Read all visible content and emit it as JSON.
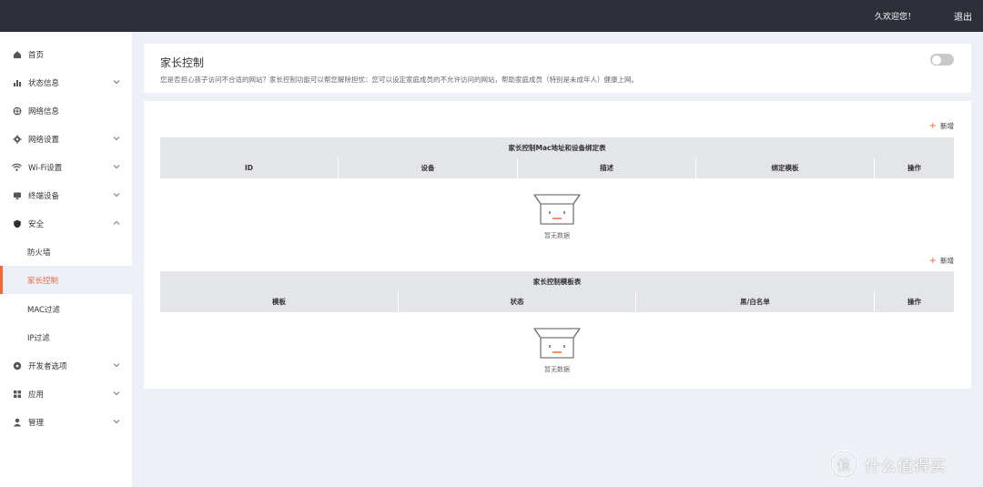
{
  "topbar": {
    "welcome": "久欢迎您！",
    "logout": "退出"
  },
  "sidebar": {
    "items": [
      {
        "label": "首页",
        "icon": "home-icon"
      },
      {
        "label": "状态信息",
        "icon": "bar-chart-icon",
        "expandable": true
      },
      {
        "label": "网络信息",
        "icon": "network-icon"
      },
      {
        "label": "网络设置",
        "icon": "gear-icon",
        "expandable": true
      },
      {
        "label": "Wi-Fi设置",
        "icon": "wifi-icon",
        "expandable": true
      },
      {
        "label": "终端设备",
        "icon": "monitor-icon",
        "expandable": true
      },
      {
        "label": "安全",
        "icon": "shield-icon",
        "expanded": true
      },
      {
        "label": "防火墙",
        "sub": true
      },
      {
        "label": "家长控制",
        "sub": true,
        "active": true
      },
      {
        "label": "MAC过滤",
        "sub": true
      },
      {
        "label": "IP过滤",
        "sub": true
      },
      {
        "label": "开发者选项",
        "icon": "developer-icon",
        "expandable": true
      },
      {
        "label": "应用",
        "icon": "apps-icon",
        "expandable": true
      },
      {
        "label": "管理",
        "icon": "user-icon",
        "expandable": true
      }
    ]
  },
  "header": {
    "title": "家长控制",
    "description": "您是否担心孩子访问不合适的网站？家长控制功能可以帮您解除担忧：您可以设定家庭成员的不允许访问的网站，帮助家庭成员（特别是未成年人）健康上网。",
    "toggle_on": false
  },
  "tables": [
    {
      "add_label": "新增",
      "title": "家长控制Mac地址和设备绑定表",
      "columns": [
        "ID",
        "设备",
        "描述",
        "绑定模板",
        "操作"
      ],
      "empty_text": "暂无数据"
    },
    {
      "add_label": "新增",
      "title": "家长控制模板表",
      "columns": [
        "模板",
        "状态",
        "黑/白名单",
        "操作"
      ],
      "empty_text": "暂无数据"
    }
  ],
  "watermark": {
    "text": "什么值得买",
    "logo": "值"
  },
  "colors": {
    "accent": "#f26a36",
    "topbar": "#2d2f38",
    "background": "#eef0f7",
    "table_header": "#e4e5e9"
  }
}
